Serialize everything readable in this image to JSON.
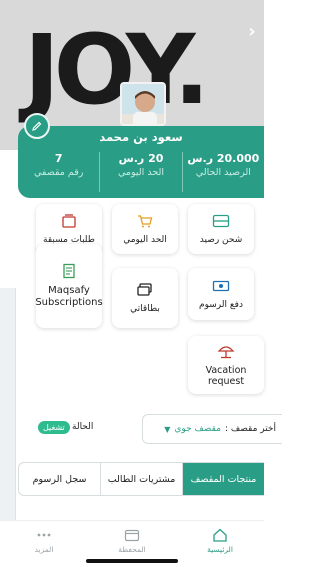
{
  "hero": {
    "banner_text": "JOY.",
    "next_icon": "chevron-right-icon"
  },
  "profile": {
    "name": "سعود بن محمد",
    "stats": [
      {
        "value": "20.000 ر.س",
        "label": "الرصيد الحالي"
      },
      {
        "value": "20 ر.س",
        "label": "الحد اليومي"
      },
      {
        "value": "7",
        "label": "رقم مقصفي"
      }
    ]
  },
  "services": {
    "charge_balance": "شحن رصيد",
    "daily_limit": "الحد اليومي",
    "pre_orders": "طلبات مسبقة",
    "pay_fees": "دفع الرسوم",
    "my_cards": "بطاقاتي",
    "maqsafy_subscriptions": "Maqsafy Subscriptions",
    "vacation_request": "Vacation request"
  },
  "filter": {
    "label": "أختر مقصف :",
    "value": "مقصف جوي",
    "status_label": "الحالة",
    "status_badge": "تشغيل"
  },
  "tabs": [
    "منتجات المقصف",
    "مشتريات الطالب",
    "سجل الرسوم"
  ],
  "bottom_nav": [
    {
      "label": "الرئيسية",
      "icon": "home-icon"
    },
    {
      "label": "المحفظة",
      "icon": "wallet-icon"
    },
    {
      "label": "المزيد",
      "icon": "more-icon"
    }
  ],
  "colors": {
    "accent": "#2a9d86",
    "badge": "#2ebc8f",
    "hero_bg": "#d9d9d9",
    "icon_red": "#c0392b"
  }
}
